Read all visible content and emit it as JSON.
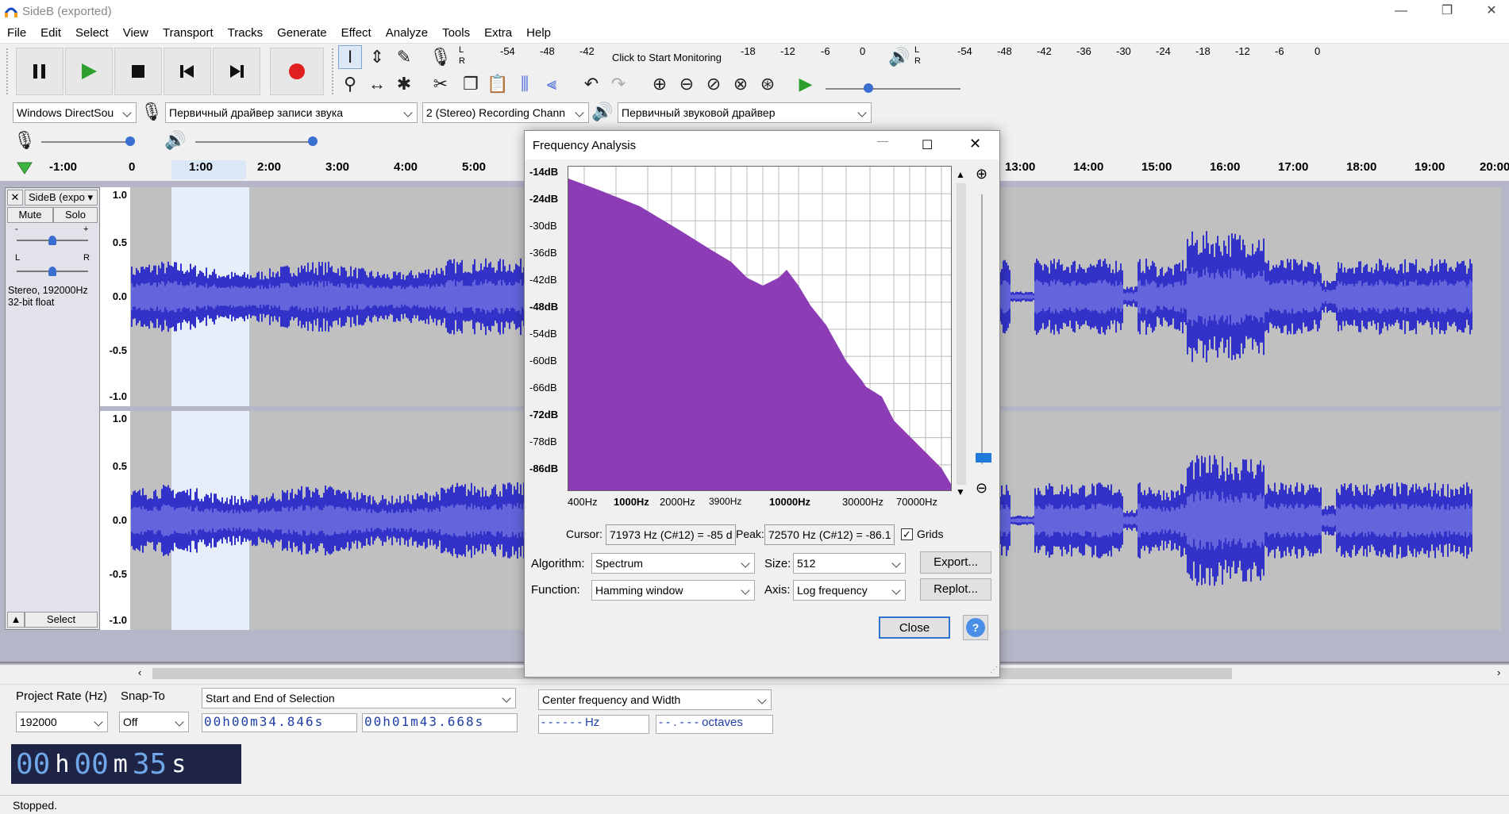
{
  "window": {
    "title": "SideB (exported)",
    "minimize": "—",
    "restore": "❐",
    "close": "✕"
  },
  "menu": [
    "File",
    "Edit",
    "Select",
    "View",
    "Transport",
    "Tracks",
    "Generate",
    "Effect",
    "Analyze",
    "Tools",
    "Extra",
    "Help"
  ],
  "meters": {
    "record_hint": "Click to Start Monitoring",
    "record_ticks": [
      "-54",
      "-48",
      "-42",
      "-18",
      "-12",
      "-6",
      "0"
    ],
    "play_ticks": [
      "-54",
      "-48",
      "-42",
      "-36",
      "-30",
      "-24",
      "-18",
      "-12",
      "-6",
      "0"
    ],
    "lr": [
      "L",
      "R"
    ]
  },
  "device": {
    "host": "Windows DirectSou",
    "rec_device": "Первичный драйвер записи звука",
    "channels": "2 (Stereo) Recording Chann",
    "play_device": "Первичный звуковой драйвер"
  },
  "ruler": {
    "ticks": [
      "-1:00",
      "0",
      "1:00",
      "2:00",
      "3:00",
      "4:00",
      "5:00",
      "13:00",
      "14:00",
      "15:00",
      "16:00",
      "17:00",
      "18:00",
      "19:00",
      "20:00"
    ]
  },
  "track": {
    "name": "SideB (expo",
    "mute": "Mute",
    "solo": "Solo",
    "pan_l": "L",
    "pan_r": "R",
    "gain_minus": "-",
    "gain_plus": "+",
    "info1": "Stereo, 192000Hz",
    "info2": "32-bit float",
    "select": "Select",
    "vruler": [
      "1.0",
      "0.5",
      "0.0",
      "-0.5",
      "-1.0"
    ]
  },
  "selection_bar": {
    "project_rate_label": "Project Rate (Hz)",
    "project_rate": "192000",
    "snap_label": "Snap-To",
    "snap": "Off",
    "sel_mode": "Start and End of Selection",
    "start": "00h00m34.846s",
    "end": "00h01m43.668s",
    "spectral_mode": "Center frequency and Width",
    "freq": "- - - - - - Hz",
    "width": "- - . - - - octaves"
  },
  "time_display": {
    "h": "00",
    "m": "00",
    "s": "35"
  },
  "status": "Stopped.",
  "dialog": {
    "title": "Frequency Analysis",
    "db_ticks": [
      "-14dB",
      "-24dB",
      "-30dB",
      "-36dB",
      "-42dB",
      "-48dB",
      "-54dB",
      "-60dB",
      "-66dB",
      "-72dB",
      "-78dB",
      "-86dB"
    ],
    "hz_ticks": [
      "400Hz",
      "1000Hz",
      "2000Hz",
      "3900Hz",
      "10000Hz",
      "30000Hz",
      "70000Hz"
    ],
    "cursor_label": "Cursor:",
    "cursor_value": "71973 Hz (C#12) = -85 d",
    "peak_label": "Peak:",
    "peak_value": "72570 Hz (C#12) = -86.1",
    "grids_label": "Grids",
    "algorithm_label": "Algorithm:",
    "algorithm": "Spectrum",
    "size_label": "Size:",
    "size": "512",
    "function_label": "Function:",
    "function": "Hamming window",
    "axis_label": "Axis:",
    "axis": "Log frequency",
    "export": "Export...",
    "replot": "Replot...",
    "close": "Close",
    "help": "?"
  },
  "colors": {
    "wave": "#3232c8",
    "wave_rms": "#6464dc",
    "spectrum": "#8c3cb4",
    "record": "#e02020",
    "play": "#2ca02c",
    "selection": "#e6eefa"
  }
}
